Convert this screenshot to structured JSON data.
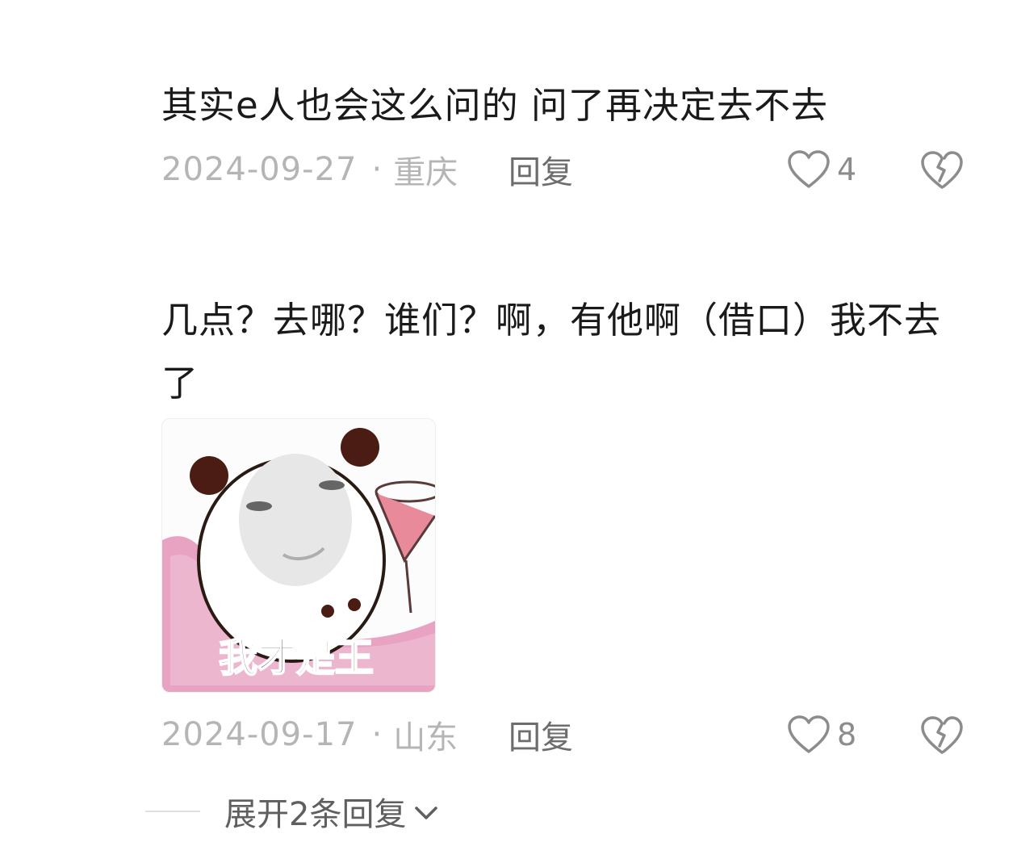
{
  "comments": [
    {
      "text": "其实e人也会这么问的 问了再决定去不去",
      "date": "2024-09-27",
      "separator": "·",
      "location": "重庆",
      "reply_label": "回复",
      "like_count": "4"
    },
    {
      "text": "几点？去哪？谁们？啊，有他啊（借口）我不去了",
      "sticker": {
        "caption": "我才是王",
        "icon": "panda-meme-sticker"
      },
      "date": "2024-09-17",
      "separator": "·",
      "location": "山东",
      "reply_label": "回复",
      "like_count": "8",
      "expand_label": "展开2条回复"
    }
  ],
  "icons": {
    "like": "heart-outline-icon",
    "dislike": "broken-heart-icon",
    "expand": "chevron-down-icon"
  },
  "colors": {
    "text_primary": "#1a1a1a",
    "meta_text": "#b5b5b5",
    "reply_text": "#6d6d6d",
    "icon": "#8c8c8c",
    "sticker_pink": "#e8a3c3"
  }
}
